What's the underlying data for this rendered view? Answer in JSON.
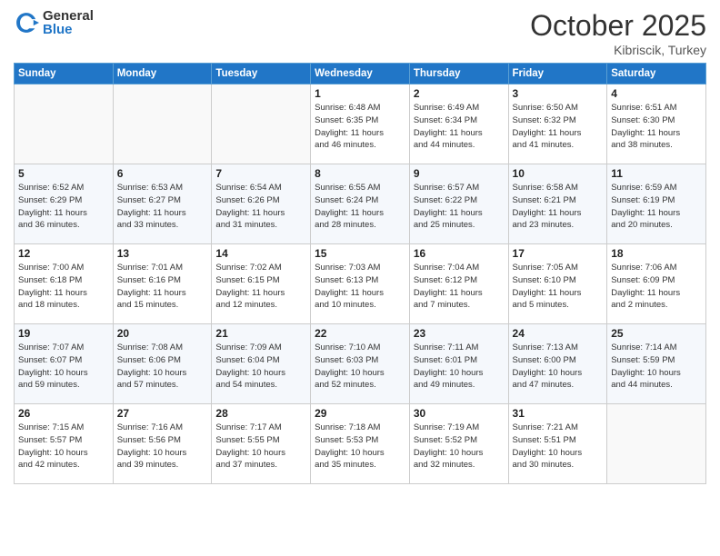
{
  "header": {
    "logo_general": "General",
    "logo_blue": "Blue",
    "month": "October 2025",
    "location": "Kibriscik, Turkey"
  },
  "weekdays": [
    "Sunday",
    "Monday",
    "Tuesday",
    "Wednesday",
    "Thursday",
    "Friday",
    "Saturday"
  ],
  "weeks": [
    [
      {
        "day": "",
        "info": ""
      },
      {
        "day": "",
        "info": ""
      },
      {
        "day": "",
        "info": ""
      },
      {
        "day": "1",
        "info": "Sunrise: 6:48 AM\nSunset: 6:35 PM\nDaylight: 11 hours\nand 46 minutes."
      },
      {
        "day": "2",
        "info": "Sunrise: 6:49 AM\nSunset: 6:34 PM\nDaylight: 11 hours\nand 44 minutes."
      },
      {
        "day": "3",
        "info": "Sunrise: 6:50 AM\nSunset: 6:32 PM\nDaylight: 11 hours\nand 41 minutes."
      },
      {
        "day": "4",
        "info": "Sunrise: 6:51 AM\nSunset: 6:30 PM\nDaylight: 11 hours\nand 38 minutes."
      }
    ],
    [
      {
        "day": "5",
        "info": "Sunrise: 6:52 AM\nSunset: 6:29 PM\nDaylight: 11 hours\nand 36 minutes."
      },
      {
        "day": "6",
        "info": "Sunrise: 6:53 AM\nSunset: 6:27 PM\nDaylight: 11 hours\nand 33 minutes."
      },
      {
        "day": "7",
        "info": "Sunrise: 6:54 AM\nSunset: 6:26 PM\nDaylight: 11 hours\nand 31 minutes."
      },
      {
        "day": "8",
        "info": "Sunrise: 6:55 AM\nSunset: 6:24 PM\nDaylight: 11 hours\nand 28 minutes."
      },
      {
        "day": "9",
        "info": "Sunrise: 6:57 AM\nSunset: 6:22 PM\nDaylight: 11 hours\nand 25 minutes."
      },
      {
        "day": "10",
        "info": "Sunrise: 6:58 AM\nSunset: 6:21 PM\nDaylight: 11 hours\nand 23 minutes."
      },
      {
        "day": "11",
        "info": "Sunrise: 6:59 AM\nSunset: 6:19 PM\nDaylight: 11 hours\nand 20 minutes."
      }
    ],
    [
      {
        "day": "12",
        "info": "Sunrise: 7:00 AM\nSunset: 6:18 PM\nDaylight: 11 hours\nand 18 minutes."
      },
      {
        "day": "13",
        "info": "Sunrise: 7:01 AM\nSunset: 6:16 PM\nDaylight: 11 hours\nand 15 minutes."
      },
      {
        "day": "14",
        "info": "Sunrise: 7:02 AM\nSunset: 6:15 PM\nDaylight: 11 hours\nand 12 minutes."
      },
      {
        "day": "15",
        "info": "Sunrise: 7:03 AM\nSunset: 6:13 PM\nDaylight: 11 hours\nand 10 minutes."
      },
      {
        "day": "16",
        "info": "Sunrise: 7:04 AM\nSunset: 6:12 PM\nDaylight: 11 hours\nand 7 minutes."
      },
      {
        "day": "17",
        "info": "Sunrise: 7:05 AM\nSunset: 6:10 PM\nDaylight: 11 hours\nand 5 minutes."
      },
      {
        "day": "18",
        "info": "Sunrise: 7:06 AM\nSunset: 6:09 PM\nDaylight: 11 hours\nand 2 minutes."
      }
    ],
    [
      {
        "day": "19",
        "info": "Sunrise: 7:07 AM\nSunset: 6:07 PM\nDaylight: 10 hours\nand 59 minutes."
      },
      {
        "day": "20",
        "info": "Sunrise: 7:08 AM\nSunset: 6:06 PM\nDaylight: 10 hours\nand 57 minutes."
      },
      {
        "day": "21",
        "info": "Sunrise: 7:09 AM\nSunset: 6:04 PM\nDaylight: 10 hours\nand 54 minutes."
      },
      {
        "day": "22",
        "info": "Sunrise: 7:10 AM\nSunset: 6:03 PM\nDaylight: 10 hours\nand 52 minutes."
      },
      {
        "day": "23",
        "info": "Sunrise: 7:11 AM\nSunset: 6:01 PM\nDaylight: 10 hours\nand 49 minutes."
      },
      {
        "day": "24",
        "info": "Sunrise: 7:13 AM\nSunset: 6:00 PM\nDaylight: 10 hours\nand 47 minutes."
      },
      {
        "day": "25",
        "info": "Sunrise: 7:14 AM\nSunset: 5:59 PM\nDaylight: 10 hours\nand 44 minutes."
      }
    ],
    [
      {
        "day": "26",
        "info": "Sunrise: 7:15 AM\nSunset: 5:57 PM\nDaylight: 10 hours\nand 42 minutes."
      },
      {
        "day": "27",
        "info": "Sunrise: 7:16 AM\nSunset: 5:56 PM\nDaylight: 10 hours\nand 39 minutes."
      },
      {
        "day": "28",
        "info": "Sunrise: 7:17 AM\nSunset: 5:55 PM\nDaylight: 10 hours\nand 37 minutes."
      },
      {
        "day": "29",
        "info": "Sunrise: 7:18 AM\nSunset: 5:53 PM\nDaylight: 10 hours\nand 35 minutes."
      },
      {
        "day": "30",
        "info": "Sunrise: 7:19 AM\nSunset: 5:52 PM\nDaylight: 10 hours\nand 32 minutes."
      },
      {
        "day": "31",
        "info": "Sunrise: 7:21 AM\nSunset: 5:51 PM\nDaylight: 10 hours\nand 30 minutes."
      },
      {
        "day": "",
        "info": ""
      }
    ]
  ]
}
